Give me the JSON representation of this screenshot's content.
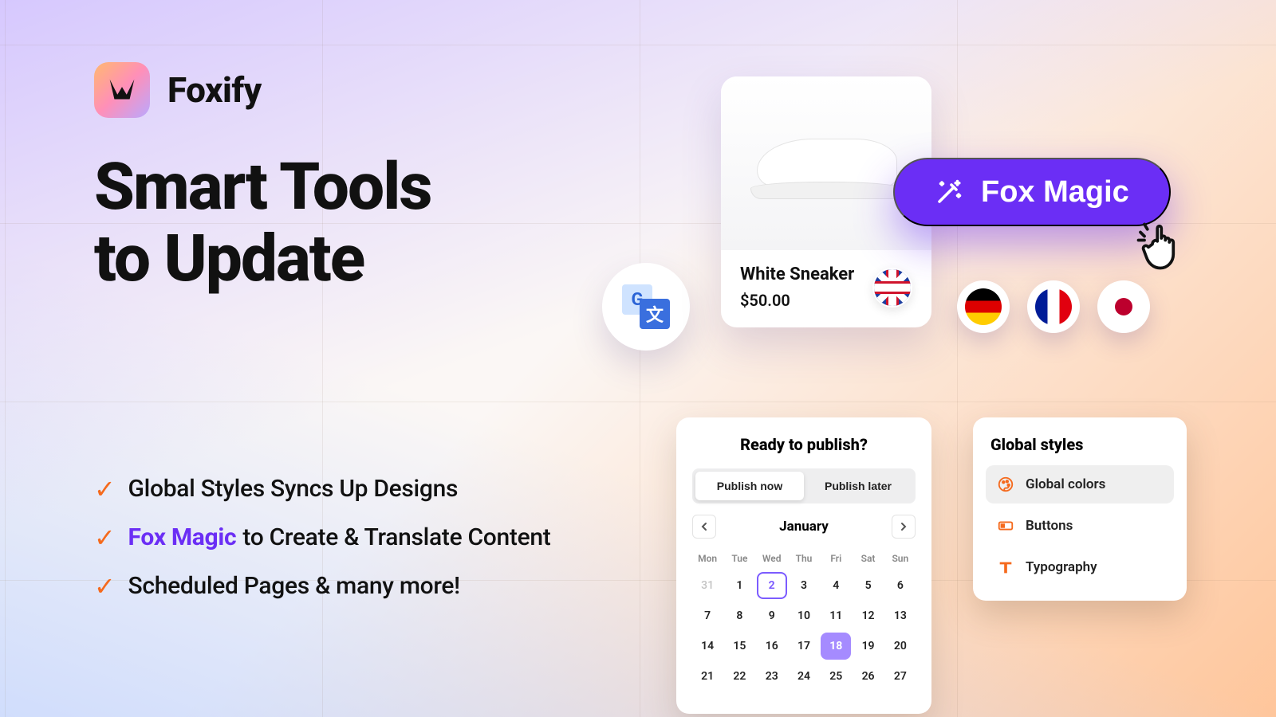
{
  "brand": {
    "name": "Foxify"
  },
  "headline": {
    "line1": "Smart Tools",
    "line2": "to Update"
  },
  "bullets": {
    "items": [
      {
        "text": "Global Styles Syncs Up Designs"
      },
      {
        "accent": "Fox Magic",
        "text": "to Create & Translate Content"
      },
      {
        "text": "Scheduled Pages & many more!"
      }
    ]
  },
  "translate": {
    "glyph_a": "G",
    "glyph_b": "文"
  },
  "product": {
    "title": "White Sneaker",
    "price": "$50.00",
    "flag": "uk"
  },
  "fox_magic": {
    "label": "Fox Magic"
  },
  "langs": [
    "de",
    "fr",
    "jp"
  ],
  "publish": {
    "heading": "Ready to publish?",
    "seg_now": "Publish now",
    "seg_later": "Publish later",
    "seg_active": "now",
    "month": "January",
    "dow": [
      "Mon",
      "Tue",
      "Wed",
      "Thu",
      "Fri",
      "Sat",
      "Sun"
    ],
    "leading_other": [
      31
    ],
    "days": [
      1,
      2,
      3,
      4,
      5,
      6,
      7,
      8,
      9,
      10,
      11,
      12,
      13,
      14,
      15,
      16,
      17,
      18,
      19,
      20,
      21,
      22,
      23,
      24,
      25,
      26,
      27
    ],
    "ring_day": 2,
    "selected_day": 18
  },
  "global_styles": {
    "heading": "Global styles",
    "items": [
      {
        "icon": "palette",
        "label": "Global colors",
        "active": true
      },
      {
        "icon": "button",
        "label": "Buttons",
        "active": false
      },
      {
        "icon": "type",
        "label": "Typography",
        "active": false
      }
    ]
  }
}
